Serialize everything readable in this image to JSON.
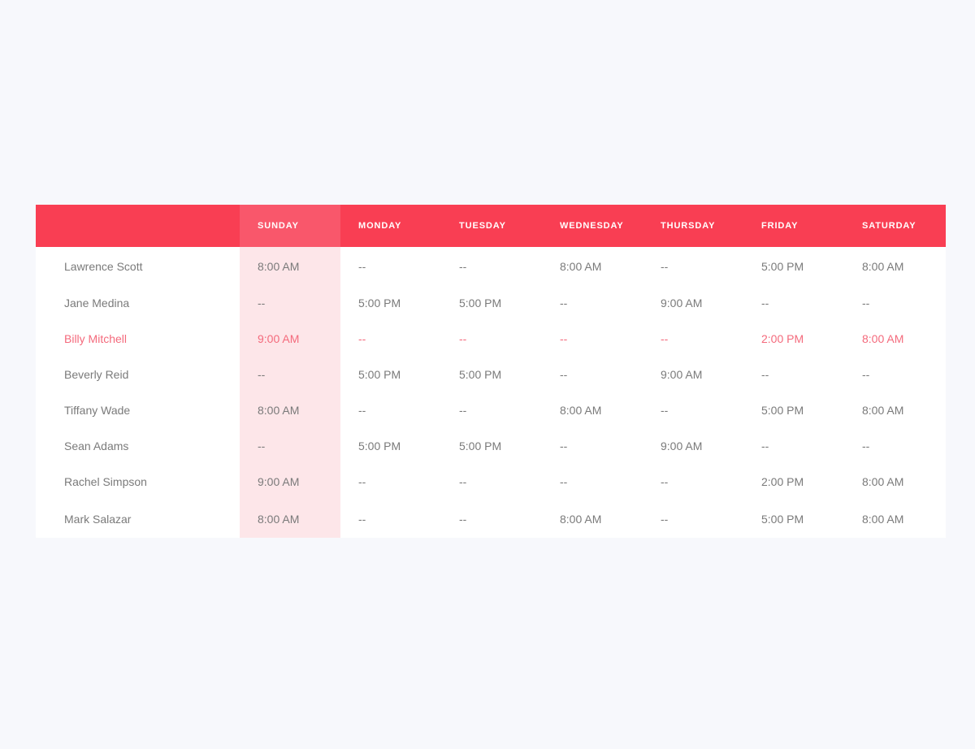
{
  "theme": {
    "page_background": "#f7f8fc",
    "header_red": "#f93e53",
    "header_sunday_red": "#f9576b",
    "sunday_column_pink": "#fde6e9",
    "row_background": "#ffffff",
    "text_gray": "#7a7a7a",
    "highlight_red": "#f46a7c"
  },
  "table": {
    "name_column_header": "",
    "highlighted_column": "SUNDAY",
    "highlighted_row_index": 2,
    "empty_value": "--",
    "columns": [
      "SUNDAY",
      "MONDAY",
      "TUESDAY",
      "WEDNESDAY",
      "THURSDAY",
      "FRIDAY",
      "SATURDAY"
    ],
    "rows": [
      {
        "name": "Lawrence Scott",
        "values": [
          "8:00 AM",
          "--",
          "--",
          "8:00 AM",
          "--",
          "5:00 PM",
          "8:00 AM"
        ]
      },
      {
        "name": "Jane Medina",
        "values": [
          "--",
          "5:00 PM",
          "5:00 PM",
          "--",
          "9:00 AM",
          "--",
          "--"
        ]
      },
      {
        "name": "Billy Mitchell",
        "values": [
          "9:00 AM",
          "--",
          "--",
          "--",
          "--",
          "2:00 PM",
          "8:00 AM"
        ]
      },
      {
        "name": "Beverly Reid",
        "values": [
          "--",
          "5:00 PM",
          "5:00 PM",
          "--",
          "9:00 AM",
          "--",
          "--"
        ]
      },
      {
        "name": "Tiffany Wade",
        "values": [
          "8:00 AM",
          "--",
          "--",
          "8:00 AM",
          "--",
          "5:00 PM",
          "8:00 AM"
        ]
      },
      {
        "name": "Sean Adams",
        "values": [
          "--",
          "5:00 PM",
          "5:00 PM",
          "--",
          "9:00 AM",
          "--",
          "--"
        ]
      },
      {
        "name": "Rachel Simpson",
        "values": [
          "9:00 AM",
          "--",
          "--",
          "--",
          "--",
          "2:00 PM",
          "8:00 AM"
        ]
      },
      {
        "name": "Mark Salazar",
        "values": [
          "8:00 AM",
          "--",
          "--",
          "8:00 AM",
          "--",
          "5:00 PM",
          "8:00 AM"
        ]
      }
    ]
  }
}
